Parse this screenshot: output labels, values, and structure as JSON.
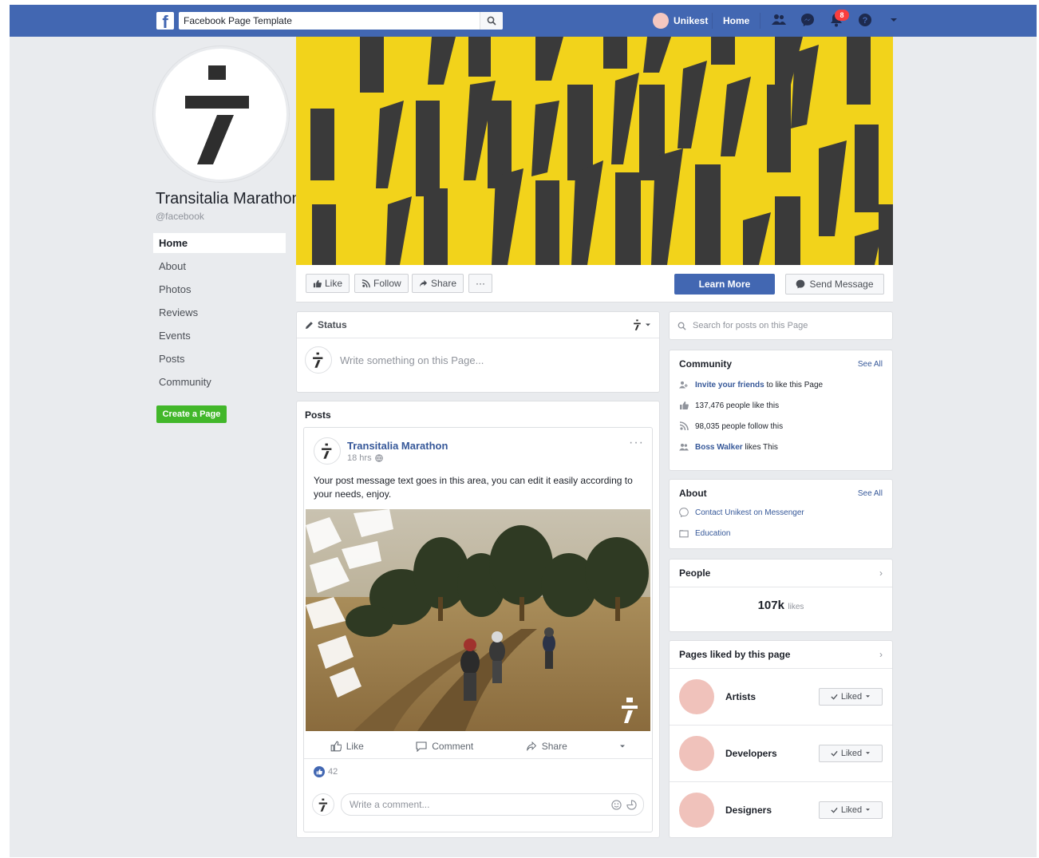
{
  "topbar": {
    "search_value": "Facebook Page Template",
    "user_name": "Unikest",
    "home_label": "Home",
    "notification_count": "8"
  },
  "page": {
    "name": "Transitalia Marathon",
    "handle": "@facebook"
  },
  "left_nav": {
    "items": [
      {
        "label": "Home"
      },
      {
        "label": "About"
      },
      {
        "label": "Photos"
      },
      {
        "label": "Reviews"
      },
      {
        "label": "Events"
      },
      {
        "label": "Posts"
      },
      {
        "label": "Community"
      }
    ],
    "create_page_label": "Create a Page"
  },
  "action_bar": {
    "like_label": "Like",
    "follow_label": "Follow",
    "share_label": "Share",
    "more_label": "···",
    "learn_more_label": "Learn More",
    "send_message_label": "Send Message"
  },
  "composer": {
    "tab_label": "Status",
    "placeholder": "Write something on this Page..."
  },
  "posts": {
    "section_title": "Posts",
    "post": {
      "author": "Transitalia Marathon",
      "time": "18 hrs",
      "text": "Your post message text goes in this area, you can edit it easily according to your needs, enjoy.",
      "like_label": "Like",
      "comment_label": "Comment",
      "share_label": "Share",
      "reaction_count": "42",
      "comment_placeholder": "Write a comment..."
    }
  },
  "right": {
    "search_placeholder": "Search for posts on this Page",
    "community": {
      "title": "Community",
      "see_all": "See All",
      "invite_link": "Invite your friends",
      "invite_rest": "to like this Page",
      "likes": "137,476 people like this",
      "follows": "98,035 people follow this",
      "friend_link": "Boss Walker",
      "friend_rest": "likes This"
    },
    "about": {
      "title": "About",
      "see_all": "See All",
      "contact": "Contact Unikest on Messenger",
      "category": "Education"
    },
    "people": {
      "title": "People",
      "count": "107k",
      "count_label": "likes"
    },
    "pages_liked": {
      "title": "Pages liked by this page",
      "items": [
        {
          "name": "Artists",
          "button": "Liked"
        },
        {
          "name": "Developers",
          "button": "Liked"
        },
        {
          "name": "Designers",
          "button": "Liked"
        }
      ]
    }
  },
  "colors": {
    "brand_blue": "#4267b2",
    "cover_yellow": "#f2d31b",
    "create_green": "#42b72a"
  }
}
